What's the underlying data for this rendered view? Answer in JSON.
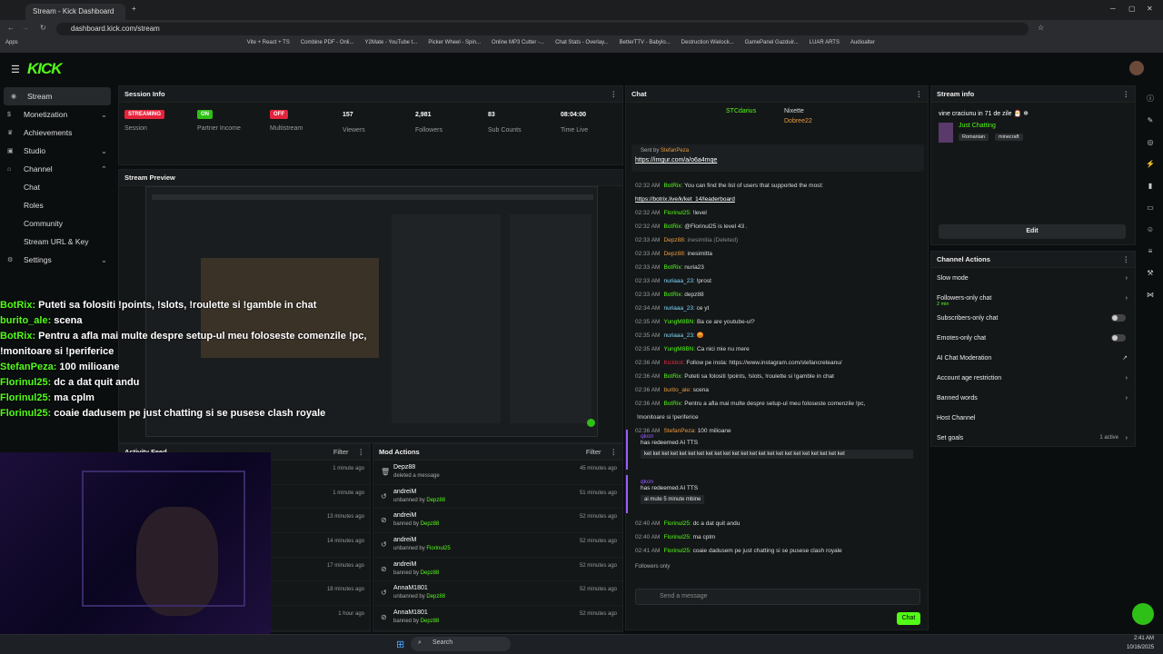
{
  "browser": {
    "tab_title": "Stream - Kick Dashboard",
    "url": "dashboard.kick.com/stream",
    "bookmarks": [
      "Apps",
      "Vite + React + TS",
      "Combine PDF - Onli...",
      "Y2Mate - YouTube t...",
      "Picker Wheel - Spin...",
      "Online MP3 Cutter -...",
      "Chat Stats - Overlay...",
      "BetterTTV - Babylo...",
      "Destruction Wielock...",
      "GamePanel Gazduir...",
      "LUAR ARTS",
      "Audioalter"
    ]
  },
  "header": {
    "logo": "KICK"
  },
  "sidebar": {
    "items": [
      {
        "label": "Stream"
      },
      {
        "label": "Monetization"
      },
      {
        "label": "Achievements"
      },
      {
        "label": "Studio"
      },
      {
        "label": "Channel"
      },
      {
        "label": "Chat"
      },
      {
        "label": "Roles"
      },
      {
        "label": "Community"
      },
      {
        "label": "Stream URL & Key"
      },
      {
        "label": "Settings"
      }
    ]
  },
  "session": {
    "title": "Session Info",
    "stats": [
      {
        "value": "STREAMING",
        "label": "Session"
      },
      {
        "value": "ON",
        "label": "Partner Income"
      },
      {
        "value": "OFF",
        "label": "Multistream"
      },
      {
        "value": "157",
        "label": "Viewers"
      },
      {
        "value": "2,981",
        "label": "Followers"
      },
      {
        "value": "83",
        "label": "Sub Counts"
      },
      {
        "value": "08:04:00",
        "label": "Time Live"
      }
    ]
  },
  "preview": {
    "title": "Stream Preview"
  },
  "overlay_chat": [
    {
      "user": "BotRix:",
      "text": " Puteti sa folositi !points, !slots, !roulette si !gamble in chat"
    },
    {
      "user": "burito_ale:",
      "text": " scena"
    },
    {
      "user": "BotRix:",
      "text": " Pentru a afla mai multe despre setup-ul meu foloseste comenzile !pc, !monitoare si !periferice"
    },
    {
      "user": "StefanPeza:",
      "text": " 100 milioane"
    },
    {
      "user": "Florinul25:",
      "text": " dc a dat     quit andu"
    },
    {
      "user": "Florinul25:",
      "text": " ma cplm"
    },
    {
      "user": "Florinul25:",
      "text": " coaie dadusem pe just chatting si se pusese clash royale"
    }
  ],
  "activity": {
    "title": "Activity Feed",
    "filter": "Filter",
    "times": [
      "1 minute ago",
      "1 minute ago",
      "13 minutes ago",
      "14 minutes ago",
      "17 minutes ago",
      "18 minutes ago",
      "1 hour ago"
    ]
  },
  "mod": {
    "title": "Mod Actions",
    "filter": "Filter",
    "rows": [
      {
        "name": "Depz88",
        "action": "deleted a message",
        "by": "",
        "time": "45 minutes ago"
      },
      {
        "name": "andreiM",
        "action": "unbanned by ",
        "by": "Depz88",
        "time": "51 minutes ago"
      },
      {
        "name": "andreiM",
        "action": "banned by ",
        "by": "Depz88",
        "time": "52 minutes ago"
      },
      {
        "name": "andreiM",
        "action": "unbanned by ",
        "by": "Florinul25",
        "time": "52 minutes ago"
      },
      {
        "name": "andreiM",
        "action": "banned by ",
        "by": "Depz88",
        "time": "52 minutes ago"
      },
      {
        "name": "AnnaM1801",
        "action": "unbanned by ",
        "by": "Depz88",
        "time": "52 minutes ago"
      },
      {
        "name": "AnnaM1801",
        "action": "banned by ",
        "by": "Depz88",
        "time": "52 minutes ago"
      }
    ]
  },
  "chat": {
    "title": "Chat",
    "top_gifters": [
      "STCdarius",
      "Nixette",
      "Dobree22"
    ],
    "pinned_sent_by": "Sent by",
    "pinned_user": "StefanPeza",
    "pinned_link": "https://imgur.com/a/o6a4mqe",
    "messages": [
      {
        "ts": "02:32 AM",
        "user": "BotRix:",
        "text": " You can find the list of users that supported the most:"
      },
      {
        "ts": "",
        "user": "",
        "text": "https://botrix.live/k/ket_14/leaderboard"
      },
      {
        "ts": "02:32 AM",
        "user": "Florinul25:",
        "text": " !level"
      },
      {
        "ts": "02:32 AM",
        "user": "BotRix:",
        "text": " @Florinul25 is level 43 ."
      },
      {
        "ts": "02:33 AM",
        "user": "Depz88:",
        "text": " inesimitia (Deleted)"
      },
      {
        "ts": "02:33 AM",
        "user": "Depz88:",
        "text": " inesimitta"
      },
      {
        "ts": "02:33 AM",
        "user": "BotRix:",
        "text": " nuria23"
      },
      {
        "ts": "02:33 AM",
        "user": "nuriaaa_23:",
        "text": " !prost"
      },
      {
        "ts": "02:33 AM",
        "user": "BotRix:",
        "text": " depz88"
      },
      {
        "ts": "02:34 AM",
        "user": "nuriaaa_23:",
        "text": " ce yt"
      },
      {
        "ts": "02:35 AM",
        "user": "YungM8BN:",
        "text": " Ba ce are youtube-ul?"
      },
      {
        "ts": "02:35 AM",
        "user": "nuriaaa_23:",
        "text": " 😡"
      },
      {
        "ts": "02:35 AM",
        "user": "YungM8BN:",
        "text": " Ca nici mie nu mere"
      },
      {
        "ts": "02:36 AM",
        "user": "Kickbot:",
        "text": " Follow pe insta: https://www.instagram.com/stefancreteanu/"
      },
      {
        "ts": "02:36 AM",
        "user": "BotRix:",
        "text": " Puteti sa folositi !points, !slots, !roulette si !gamble in chat"
      },
      {
        "ts": "02:36 AM",
        "user": "burito_ale:",
        "text": " scena"
      },
      {
        "ts": "02:36 AM",
        "user": "BotRix:",
        "text": " Pentru a afla mai multe despre setup-ul meu foloseste comenzile !pc,"
      },
      {
        "ts": "",
        "user": "",
        "text": "!monitoare si !periferice"
      },
      {
        "ts": "02:36 AM",
        "user": "StefanPeza:",
        "text": " 100 milioane"
      }
    ],
    "redeem1": {
      "user": "qkon",
      "text": "has redeemed AI TTS",
      "msg": "ket ket ket ket ket ket ket ket ket ket ket ket ket ket ket ket ket ket ket ket ket ket ket"
    },
    "redeem2": {
      "user": "qkon",
      "text": "has redeemed AI TTS",
      "msg": "ai mute 5 minute mbine"
    },
    "messages2": [
      {
        "ts": "02:40 AM",
        "user": "Florinul25:",
        "text": " dc a dat     quit andu"
      },
      {
        "ts": "02:40 AM",
        "user": "Florinul25:",
        "text": " ma cplm"
      },
      {
        "ts": "02:41 AM",
        "user": "Florinul25:",
        "text": " coaie dadusem pe just chatting si se pusese clash royale"
      }
    ],
    "followers_only": "Followers only",
    "placeholder": "Send a message",
    "send": "Chat"
  },
  "stream_info": {
    "title": "Stream info",
    "stream_title": "vine craciunu in 71 de zile 🎅 ❄",
    "category": "Just Chatting",
    "tags": [
      "Romanian",
      "minecraft"
    ],
    "edit": "Edit"
  },
  "channel_actions": {
    "title": "Channel Actions",
    "items": [
      {
        "label": "Slow mode",
        "sub": ""
      },
      {
        "label": "Followers-only chat",
        "sub": "2 min"
      },
      {
        "label": "Subscribers-only chat",
        "sub": ""
      },
      {
        "label": "Emotes-only chat",
        "sub": ""
      },
      {
        "label": "AI Chat Moderation",
        "sub": ""
      },
      {
        "label": "Account age restriction",
        "sub": ""
      },
      {
        "label": "Banned words",
        "sub": ""
      },
      {
        "label": "Host Channel",
        "sub": ""
      },
      {
        "label": "Set goals",
        "sub": ""
      }
    ],
    "goals_active": "1 active"
  },
  "taskbar": {
    "search": "Search",
    "time": "2:41 AM",
    "date": "10/16/2025"
  }
}
